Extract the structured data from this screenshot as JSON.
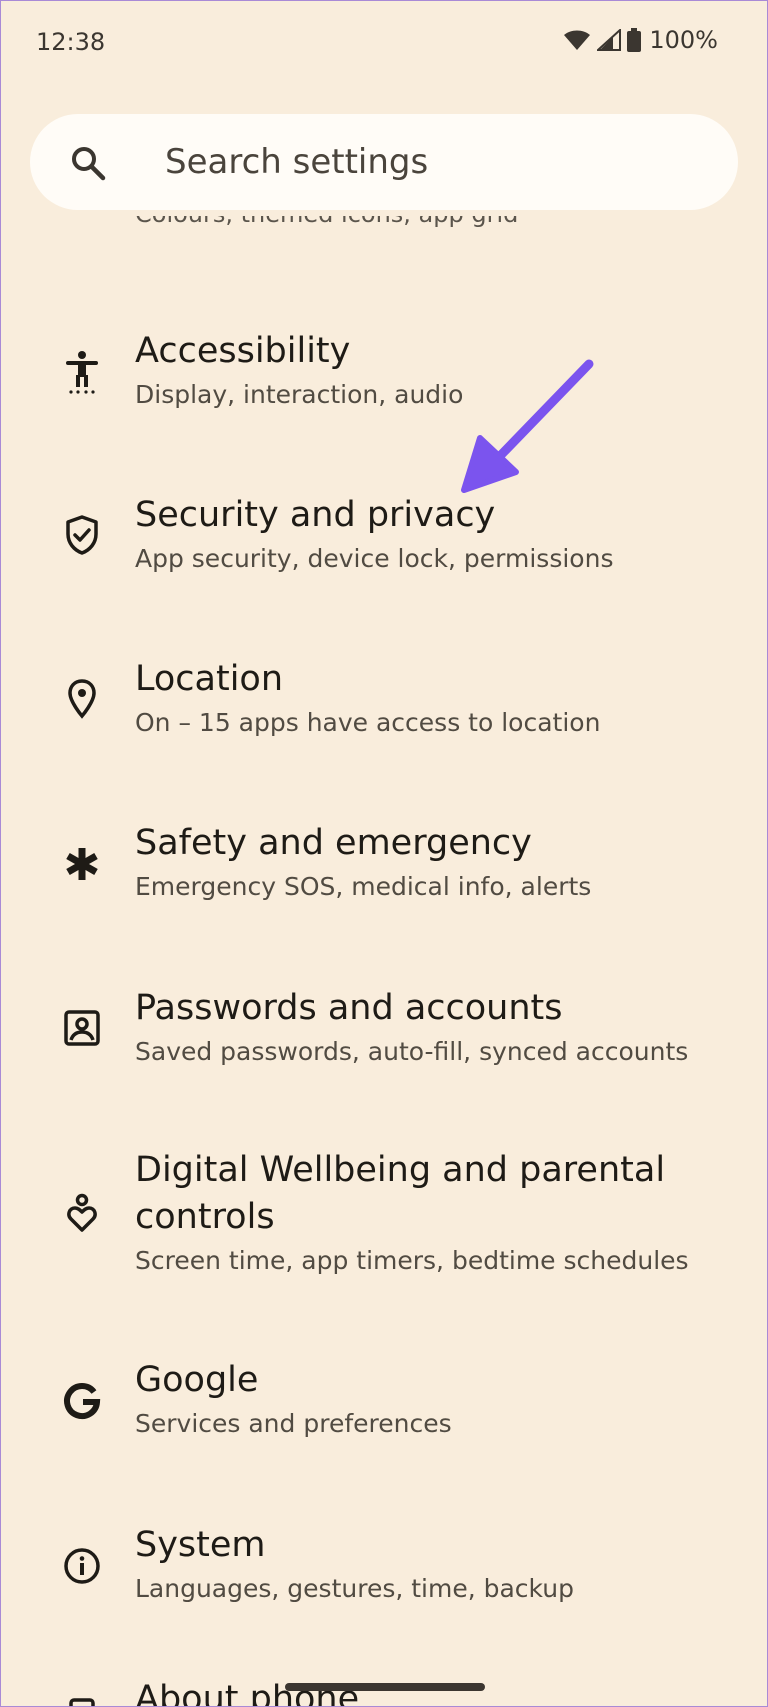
{
  "status_bar": {
    "time": "12:38",
    "battery_percent": "100%"
  },
  "search": {
    "placeholder": "Search settings"
  },
  "partial_subtitle": "Colours, themed icons, app grid",
  "items": [
    {
      "icon": "accessibility-icon",
      "title": "Accessibility",
      "subtitle": "Display, interaction, audio"
    },
    {
      "icon": "shield-check-icon",
      "title": "Security and privacy",
      "subtitle": "App security, device lock, permissions"
    },
    {
      "icon": "location-pin-icon",
      "title": "Location",
      "subtitle": "On – 15 apps have access to location"
    },
    {
      "icon": "asterisk-icon",
      "title": "Safety and emergency",
      "subtitle": "Emergency SOS, medical info, alerts"
    },
    {
      "icon": "account-box-icon",
      "title": "Passwords and accounts",
      "subtitle": "Saved passwords, auto-fill, synced accounts"
    },
    {
      "icon": "wellbeing-icon",
      "title_line1": "Digital Wellbeing and parental",
      "title_line2": "controls",
      "subtitle": "Screen time, app timers, bedtime schedules"
    },
    {
      "icon": "google-icon",
      "title": "Google",
      "subtitle": "Services and preferences"
    },
    {
      "icon": "info-icon",
      "title": "System",
      "subtitle": "Languages, gestures, time, backup"
    },
    {
      "icon": "phone-icon",
      "title": "About phone"
    }
  ],
  "colors": {
    "background": "#f9eddc",
    "search_bg": "#fffcf7",
    "annotation_arrow": "#7b54ee"
  }
}
